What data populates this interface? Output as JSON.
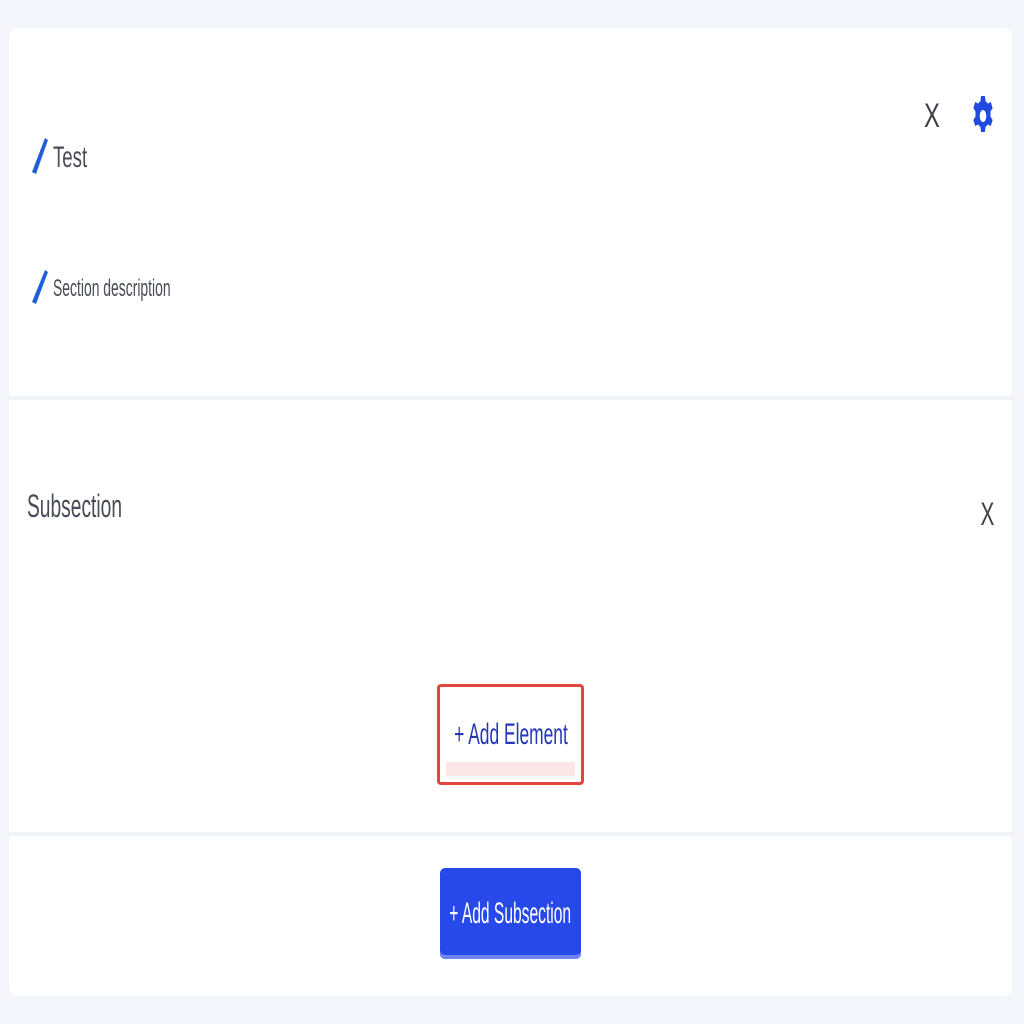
{
  "section": {
    "title": "Test",
    "description": "Section description",
    "close_label": "X",
    "icons": {
      "edit_title": "pencil-icon",
      "edit_description": "pencil-icon",
      "settings": "gear-icon"
    }
  },
  "subsection": {
    "title": "Subsection",
    "close_label": "X",
    "add_element_label": "+ Add Element"
  },
  "footer": {
    "add_subsection_label": "+ Add Subsection"
  },
  "colors": {
    "accent": "#2849ea",
    "highlight_border": "#e2453d",
    "link_text": "#2536b8",
    "pencil": "#1f5fd6"
  }
}
